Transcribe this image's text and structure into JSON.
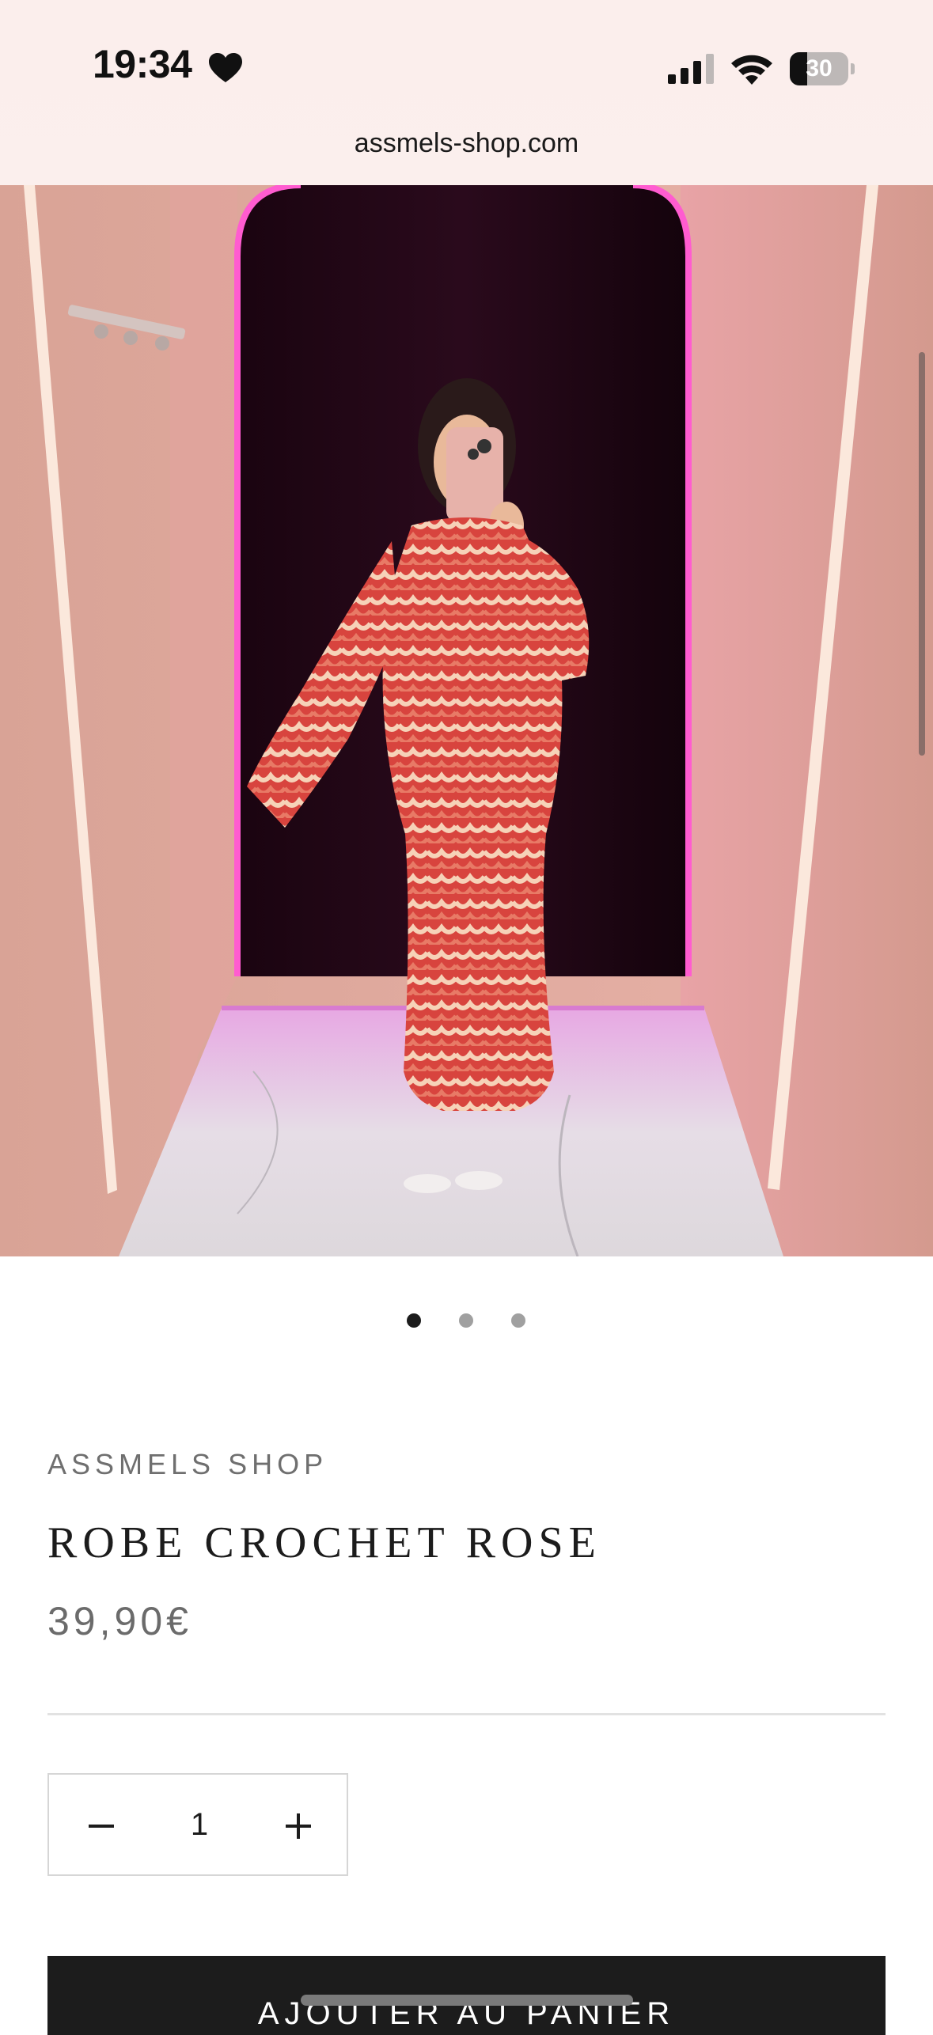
{
  "status_bar": {
    "time": "19:34",
    "heart_icon": "heart-icon",
    "signal_icon": "cellular-signal-icon",
    "wifi_icon": "wifi-icon",
    "battery_level": "30",
    "battery_fraction": 0.3
  },
  "browser": {
    "url": "assmels-shop.com"
  },
  "product": {
    "vendor": "ASSMELS SHOP",
    "title": "ROBE CROCHET ROSE",
    "price": "39,90€",
    "image_count": 3,
    "active_image_index": 0,
    "quantity": "1",
    "decrease_icon": "minus-icon",
    "increase_icon": "plus-icon",
    "add_to_cart_label": "AJOUTER AU PANIER"
  },
  "colors": {
    "accent": "#1c1c1c",
    "status_bar_bg": "#fbeeec",
    "muted_text": "#6f6f6f",
    "dot_inactive": "#a0a0a0"
  }
}
